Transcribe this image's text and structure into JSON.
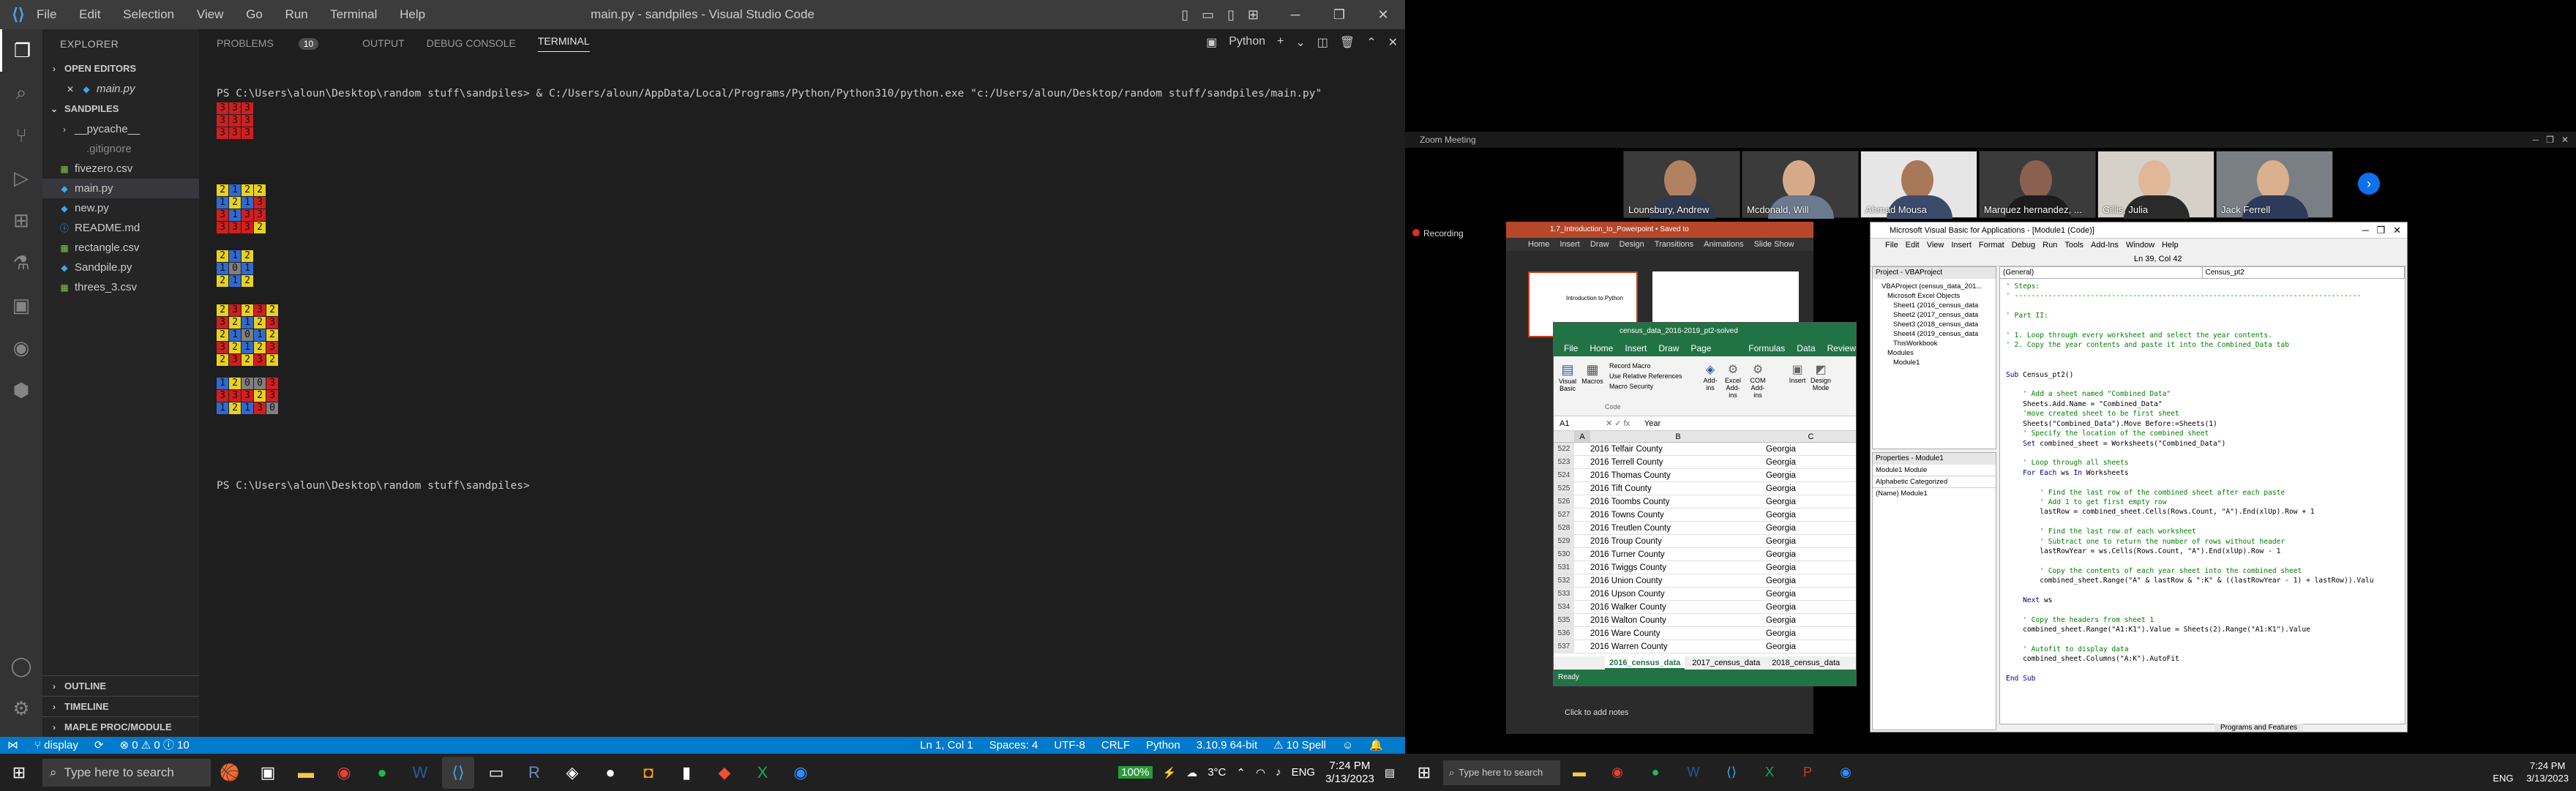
{
  "vscode": {
    "window_title": "main.py - sandpiles - Visual Studio Code",
    "menu": [
      "File",
      "Edit",
      "Selection",
      "View",
      "Go",
      "Run",
      "Terminal",
      "Help"
    ],
    "explorer_header": "EXPLORER",
    "open_editors_label": "OPEN EDITORS",
    "open_editor_file": "main.py",
    "project_label": "SANDPILES",
    "files": [
      "__pycache__",
      ".gitignore",
      "fivezero.csv",
      "main.py",
      "new.py",
      "README.md",
      "rectangle.csv",
      "Sandpile.py",
      "threes_3.csv"
    ],
    "selected_file": "main.py",
    "outline_label": "OUTLINE",
    "timeline_label": "TIMELINE",
    "maple_label": "MAPLE PROC/MODULE",
    "panel_tabs": {
      "problems": "PROBLEMS",
      "problems_count": "10",
      "output": "OUTPUT",
      "debug": "DEBUG CONSOLE",
      "terminal": "TERMINAL"
    },
    "terminal_profile": "Python",
    "terminal_cmd": "PS C:\\Users\\aloun\\Desktop\\random stuff\\sandpiles> & C:/Users/aloun/AppData/Local/Programs/Python/Python310/python.exe \"c:/Users/aloun/Desktop/random stuff/sandpiles/main.py\"",
    "terminal_prompt": "PS C:\\Users\\aloun\\Desktop\\random stuff\\sandpiles>",
    "grids": [
      [
        [
          "3",
          "3",
          "3"
        ],
        [
          "3",
          "3",
          "3"
        ],
        [
          "3",
          "3",
          "3"
        ]
      ],
      [
        [
          "2",
          "1",
          "2",
          "2"
        ],
        [
          "1",
          "2",
          "1",
          "3"
        ],
        [
          "3",
          "1",
          "3",
          "3"
        ],
        [
          "3",
          "3",
          "3",
          "2"
        ]
      ],
      [
        [
          "2",
          "1",
          "2"
        ],
        [
          "1",
          "0",
          "1"
        ],
        [
          "2",
          "1",
          "2"
        ]
      ],
      [
        [
          "2",
          "3",
          "2",
          "3",
          "2"
        ],
        [
          "3",
          "2",
          "1",
          "2",
          "3"
        ],
        [
          "2",
          "1",
          "0",
          "1",
          "2"
        ],
        [
          "3",
          "2",
          "1",
          "2",
          "3"
        ],
        [
          "2",
          "3",
          "2",
          "3",
          "2"
        ]
      ],
      [
        [
          "1",
          "2",
          "0",
          "0",
          "3"
        ],
        [
          "3",
          "3",
          "3",
          "2",
          "3"
        ],
        [
          "1",
          "2",
          "1",
          "3",
          "0"
        ]
      ]
    ],
    "status": {
      "branch": "display",
      "problems": "⊗ 0 ⚠ 0 ⓘ 10",
      "position": "Ln 1, Col 1",
      "spaces": "Spaces: 4",
      "encoding": "UTF-8",
      "eol": "CRLF",
      "language": "Python",
      "interpreter": "3.10.9 64-bit",
      "spell": "⚠ 10 Spell"
    },
    "taskbar": {
      "search": "Type here to search",
      "battery": "100%",
      "temp": "3°C",
      "lang": "ENG",
      "time": "7:24 PM",
      "date": "3/13/2023"
    }
  },
  "colors": {
    "cell0": "#7f7f7f",
    "cell1": "#2f6ad0",
    "cell2": "#e8d21e",
    "cell3": "#d11e1e",
    "statusbar": "#007acc"
  },
  "zoom": {
    "title": "Zoom Meeting",
    "participants": [
      "Lounsbury, Andrew",
      "Mcdonald, Will",
      "Ahmad Mousa",
      "Marquez hernandez, ...",
      "Gillis, Julia",
      "Jack Ferrell"
    ],
    "recording": "Recording"
  },
  "powerpoint": {
    "tabs": [
      "Home",
      "Insert",
      "Draw",
      "Design",
      "Transitions",
      "Animations",
      "Slide Show"
    ],
    "title": "1.7_Introduction_to_Powerpoint • Saved to",
    "slide_title": "Introduction to Python",
    "notes": "Click to add notes"
  },
  "excel": {
    "title": "census_data_2016-2019_pt2-solved",
    "tabs": [
      "File",
      "Home",
      "Insert",
      "Draw",
      "Page Layout",
      "Formulas",
      "Data",
      "Review"
    ],
    "name_box": "A1",
    "formula": "Year",
    "ribbon": {
      "record": "Record Macro",
      "relative": "Use Relative References",
      "security": "Macro Security",
      "vb": "Visual Basic",
      "macros": "Macros",
      "code": "Code",
      "addins": "Add-ins",
      "excel_addins": "Excel Add-ins",
      "com": "COM Add-ins",
      "insert": "Insert",
      "design": "Design Mode"
    },
    "columns": [
      "A",
      "B",
      "C"
    ],
    "rows": [
      {
        "n": "522",
        "y": "2016",
        "county": "Telfair County",
        "state": "Georgia"
      },
      {
        "n": "523",
        "y": "2016",
        "county": "Terrell County",
        "state": "Georgia"
      },
      {
        "n": "524",
        "y": "2016",
        "county": "Thomas County",
        "state": "Georgia"
      },
      {
        "n": "525",
        "y": "2016",
        "county": "Tift County",
        "state": "Georgia"
      },
      {
        "n": "526",
        "y": "2016",
        "county": "Toombs County",
        "state": "Georgia"
      },
      {
        "n": "527",
        "y": "2016",
        "county": "Towns County",
        "state": "Georgia"
      },
      {
        "n": "528",
        "y": "2016",
        "county": "Treutlen County",
        "state": "Georgia"
      },
      {
        "n": "529",
        "y": "2016",
        "county": "Troup County",
        "state": "Georgia"
      },
      {
        "n": "530",
        "y": "2016",
        "county": "Turner County",
        "state": "Georgia"
      },
      {
        "n": "531",
        "y": "2016",
        "county": "Twiggs County",
        "state": "Georgia"
      },
      {
        "n": "532",
        "y": "2016",
        "county": "Union County",
        "state": "Georgia"
      },
      {
        "n": "533",
        "y": "2016",
        "county": "Upson County",
        "state": "Georgia"
      },
      {
        "n": "534",
        "y": "2016",
        "county": "Walker County",
        "state": "Georgia"
      },
      {
        "n": "535",
        "y": "2016",
        "county": "Walton County",
        "state": "Georgia"
      },
      {
        "n": "536",
        "y": "2016",
        "county": "Ware County",
        "state": "Georgia"
      },
      {
        "n": "537",
        "y": "2016",
        "county": "Warren County",
        "state": "Georgia"
      }
    ],
    "sheets": [
      "2016_census_data",
      "2017_census_data",
      "2018_census_data"
    ],
    "status": "Ready"
  },
  "vba": {
    "title": "Microsoft Visual Basic for Applications - [Module1 (Code)]",
    "menu": [
      "File",
      "Edit",
      "View",
      "Insert",
      "Format",
      "Debug",
      "Run",
      "Tools",
      "Add-Ins",
      "Window",
      "Help"
    ],
    "cursor": "Ln 39, Col 42",
    "project_title": "Project - VBAProject",
    "tree": [
      "VBAProject (census_data_201...",
      "Microsoft Excel Objects",
      "Sheet1 (2016_census_data",
      "Sheet2 (2017_census_data",
      "Sheet3 (2018_census_data",
      "Sheet4 (2019_census_data",
      "ThisWorkbook",
      "Modules",
      "Module1"
    ],
    "props_title": "Properties - Module1",
    "props_obj": "Module1 Module",
    "props_tabs": "Alphabetic  Categorized",
    "props_name": "(Name)  Module1",
    "dd_left": "(General)",
    "dd_right": "Census_pt2",
    "code": "' Steps:\n' ----------------------------------------------------------------------------------\n\n' Part II:\n\n' 1. Loop through every worksheet and select the year contents.\n' 2. Copy the year contents and paste it into the Combined_Data tab\n\n\nSub Census_pt2()\n\n    ' Add a sheet named \"Combined Data\"\n    Sheets.Add.Name = \"Combined_Data\"\n    'move created sheet to be first sheet\n    Sheets(\"Combined_Data\").Move Before:=Sheets(1)\n    ' Specify the location of the combined sheet\n    Set combined_sheet = Worksheets(\"Combined_Data\")\n\n    ' Loop through all sheets\n    For Each ws In Worksheets\n\n        ' Find the last row of the combined sheet after each paste\n        ' Add 1 to get first empty row\n        lastRow = combined_sheet.Cells(Rows.Count, \"A\").End(xlUp).Row + 1\n\n        ' Find the last row of each worksheet\n        ' Subtract one to return the number of rows without header\n        lastRowYear = ws.Cells(Rows.Count, \"A\").End(xlUp).Row - 1\n\n        ' Copy the contents of each year sheet into the combined sheet\n        combined_sheet.Range(\"A\" & lastRow & \":K\" & ((lastRowYear - 1) + lastRow)).Valu\n\n    Next ws\n\n    ' Copy the headers from sheet 1\n    combined_sheet.Range(\"A1:K1\").Value = Sheets(2).Range(\"A1:K1\").Value\n\n    ' Autofit to display data\n    combined_sheet.Columns(\"A:K\").AutoFit\n\nEnd Sub",
    "status": "Programs and Features"
  },
  "taskbar2": {
    "search": "Type here to search",
    "lang": "ENG",
    "time": "7:24 PM",
    "date": "3/13/2023"
  }
}
